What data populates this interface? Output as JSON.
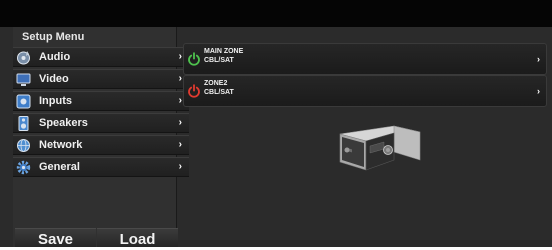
{
  "sidebar": {
    "title": "Setup Menu",
    "items": [
      {
        "label": "Audio",
        "icon": "audio-icon"
      },
      {
        "label": "Video",
        "icon": "video-icon"
      },
      {
        "label": "Inputs",
        "icon": "inputs-icon"
      },
      {
        "label": "Speakers",
        "icon": "speakers-icon"
      },
      {
        "label": "Network",
        "icon": "network-icon"
      },
      {
        "label": "General",
        "icon": "gear-icon"
      }
    ],
    "arrow": "›"
  },
  "buttons": {
    "save_label": "Save",
    "load_label": "Load"
  },
  "zones": [
    {
      "name": "MAIN ZONE",
      "source": "CBL/SAT",
      "power_color": "#4ec24e",
      "arrow": "›"
    },
    {
      "name": "ZONE2",
      "source": "CBL/SAT",
      "power_color": "#e03a2f",
      "arrow": "›"
    }
  ],
  "colors": {
    "power_on": "#4ec24e",
    "power_off": "#e03a2f"
  }
}
